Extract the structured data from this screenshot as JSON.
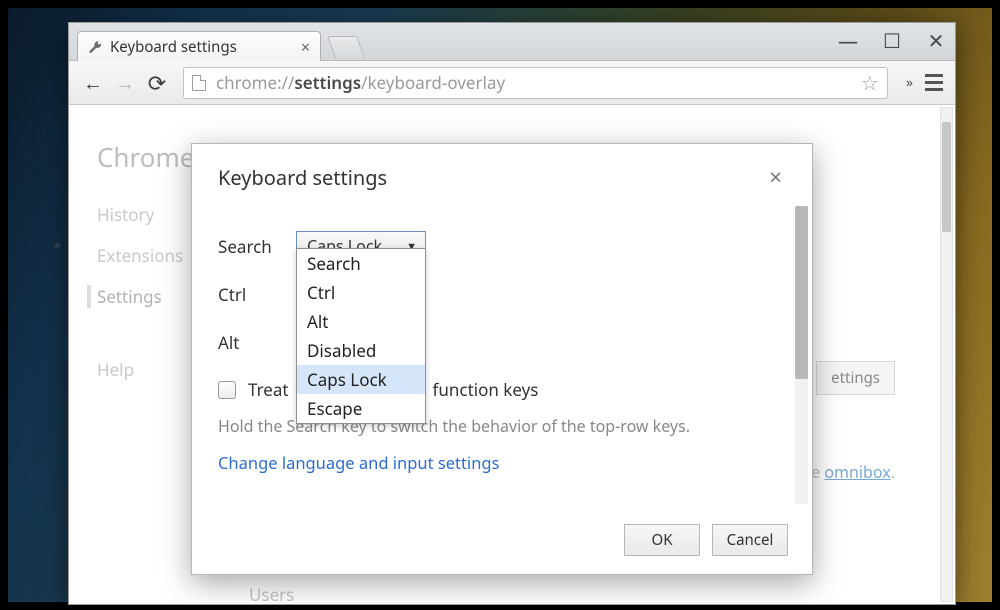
{
  "window": {
    "minimize_glyph": "—",
    "maximize_glyph": "☐",
    "close_glyph": "✕"
  },
  "tab": {
    "title": "Keyboard settings",
    "close_glyph": "×"
  },
  "toolbar": {
    "back_glyph": "←",
    "forward_glyph": "→",
    "reload_glyph": "⟳",
    "url_prefix": "chrome://",
    "url_bold": "settings",
    "url_suffix": "/keyboard-overlay",
    "star_glyph": "☆",
    "more_glyph": "»"
  },
  "bg_page": {
    "heading": "Chrome",
    "sidebar": [
      "History",
      "Extensions",
      "Settings",
      "Help"
    ],
    "button_obscured": "ettings",
    "omnibox_prefix": "e ",
    "omnibox_link": "omnibox",
    "omnibox_period": ".",
    "users_heading": "Users"
  },
  "dialog": {
    "title": "Keyboard settings",
    "close_glyph": "×",
    "rows": {
      "search": "Search",
      "ctrl": "Ctrl",
      "alt": "Alt"
    },
    "selected_value": "Caps Lock",
    "caret_glyph": "▼",
    "options": [
      "Search",
      "Ctrl",
      "Alt",
      "Disabled",
      "Caps Lock",
      "Escape"
    ],
    "selected_index": 4,
    "checkbox_left": "Treat",
    "checkbox_right": "function keys",
    "hint": "Hold the Search key to switch the behavior of the top-row keys.",
    "link": "Change language and input settings",
    "ok": "OK",
    "cancel": "Cancel"
  }
}
